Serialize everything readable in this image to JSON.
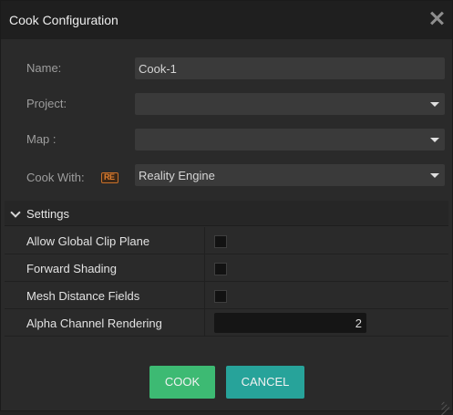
{
  "dialog": {
    "title": "Cook Configuration"
  },
  "form": {
    "name_label": "Name:",
    "name_value": "Cook-1",
    "project_label": "Project:",
    "project_value": "",
    "map_label": "Map :",
    "map_value": "",
    "cook_with_label": "Cook With:",
    "cook_with_logo_text": "RE",
    "cook_with_value": "Reality Engine"
  },
  "settings": {
    "title": "Settings",
    "properties": [
      {
        "label": "Allow Global Clip Plane",
        "type": "checkbox",
        "checked": false
      },
      {
        "label": "Forward Shading",
        "type": "checkbox",
        "checked": false
      },
      {
        "label": "Mesh Distance Fields",
        "type": "checkbox",
        "checked": false
      },
      {
        "label": "Alpha Channel Rendering",
        "type": "number",
        "value": "2"
      }
    ]
  },
  "buttons": {
    "cook": "COOK",
    "cancel": "CANCEL"
  },
  "colors": {
    "cook_button": "#3dba73",
    "cancel_button": "#27a39a",
    "logo_accent": "#e07e2e"
  },
  "icons": {
    "close": "close-icon",
    "dropdown": "chevron-down-icon",
    "collapse": "chevron-down-icon",
    "resize": "resize-grip-icon"
  }
}
